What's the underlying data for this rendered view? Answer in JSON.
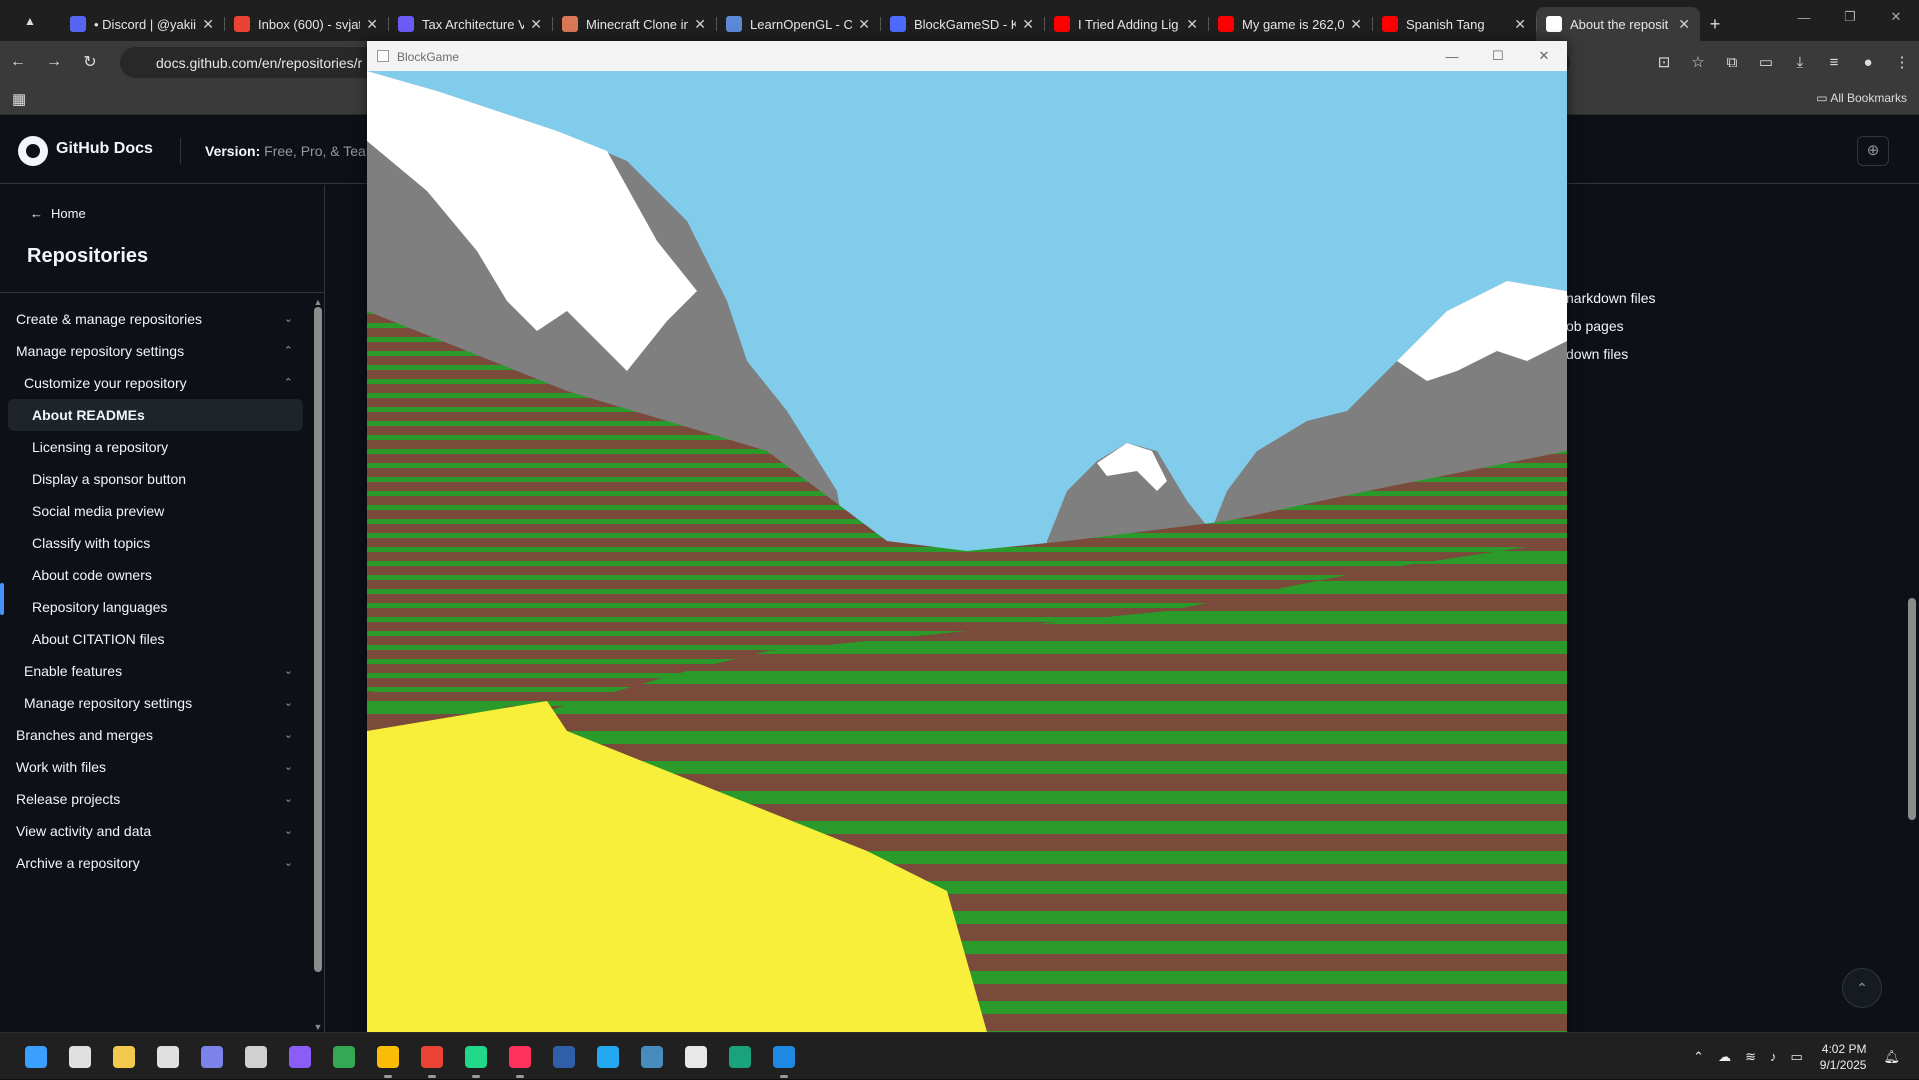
{
  "browser": {
    "tabs": [
      {
        "title": "• Discord | @yakii",
        "color": "#5865f2",
        "active": false
      },
      {
        "title": "Inbox (600) - svjat",
        "color": "#ea4335",
        "active": false
      },
      {
        "title": "Tax Architecture V",
        "color": "#6b5cf6",
        "active": false
      },
      {
        "title": "Minecraft Clone in",
        "color": "#d97757",
        "active": false
      },
      {
        "title": "LearnOpenGL - C",
        "color": "#5c8ad6",
        "active": false
      },
      {
        "title": "BlockGameSD - K",
        "color": "#4d6bfe",
        "active": false
      },
      {
        "title": "I Tried Adding Lig",
        "color": "#ff0000",
        "active": false
      },
      {
        "title": "My game is 262,0",
        "color": "#ff0000",
        "active": false
      },
      {
        "title": "Spanish Tang",
        "color": "#ff0000",
        "active": false
      },
      {
        "title": "About the reposit",
        "color": "#ffffff",
        "active": true
      }
    ],
    "url": "docs.github.com/en/repositories/r",
    "bookmarks_all": "All Bookmarks"
  },
  "docs": {
    "brand": "GitHub Docs",
    "version_label": "Version:",
    "version_value": "Free, Pro, & Team",
    "home_link": "Home",
    "section_title": "Repositories",
    "nav": [
      {
        "label": "Create & manage repositories",
        "level": 0,
        "chevron": "down"
      },
      {
        "label": "Manage repository settings",
        "level": 0,
        "chevron": "up"
      },
      {
        "label": "Customize your repository",
        "level": 1,
        "chevron": "up"
      },
      {
        "label": "About READMEs",
        "level": 2,
        "chevron": "",
        "active": true
      },
      {
        "label": "Licensing a repository",
        "level": 2,
        "chevron": ""
      },
      {
        "label": "Display a sponsor button",
        "level": 2,
        "chevron": ""
      },
      {
        "label": "Social media preview",
        "level": 2,
        "chevron": ""
      },
      {
        "label": "Classify with topics",
        "level": 2,
        "chevron": ""
      },
      {
        "label": "About code owners",
        "level": 2,
        "chevron": ""
      },
      {
        "label": "Repository languages",
        "level": 2,
        "chevron": ""
      },
      {
        "label": "About CITATION files",
        "level": 2,
        "chevron": ""
      },
      {
        "label": "Enable features",
        "level": 1,
        "chevron": "down"
      },
      {
        "label": "Manage repository settings",
        "level": 1,
        "chevron": "down"
      },
      {
        "label": "Branches and merges",
        "level": 0,
        "chevron": "down"
      },
      {
        "label": "Work with files",
        "level": 0,
        "chevron": "down"
      },
      {
        "label": "Release projects",
        "level": 0,
        "chevron": "down"
      },
      {
        "label": "View activity and data",
        "level": 0,
        "chevron": "down"
      },
      {
        "label": "Archive a repository",
        "level": 0,
        "chevron": "down"
      }
    ],
    "visible_links": [
      "narkdown files",
      "ob pages",
      "down files"
    ]
  },
  "game_window": {
    "title": "BlockGame",
    "colors": {
      "sky": "#81cceb",
      "snow": "#ffffff",
      "stone": "#7f7f7f",
      "dirt": "#7a4a3a",
      "grass": "#2a9a2a",
      "sand": "#f7ef3a"
    }
  },
  "taskbar": {
    "time": "4:02 PM",
    "date": "9/1/2025",
    "apps": [
      {
        "name": "start-icon",
        "color": "#3aa0ff"
      },
      {
        "name": "search-icon",
        "color": "#e0e0e0"
      },
      {
        "name": "file-explorer-icon",
        "color": "#f2c94c"
      },
      {
        "name": "twitch-icon",
        "color": "#e0e0e0"
      },
      {
        "name": "teams-icon",
        "color": "#7b83eb"
      },
      {
        "name": "xbox-icon",
        "color": "#d0d0d0"
      },
      {
        "name": "obsidian-icon",
        "color": "#8b5cf6"
      },
      {
        "name": "chrome-icon",
        "color": "#34a853"
      },
      {
        "name": "chrome-profile-icon",
        "color": "#fbbc05"
      },
      {
        "name": "chrome-active-icon",
        "color": "#ea4335"
      },
      {
        "name": "clion-icon",
        "color": "#21d789"
      },
      {
        "name": "intellij-icon",
        "color": "#fe315d"
      },
      {
        "name": "powershell-icon",
        "color": "#2f5fa8"
      },
      {
        "name": "vscode-icon",
        "color": "#23a9f2"
      },
      {
        "name": "godot-icon",
        "color": "#478cbf"
      },
      {
        "name": "notepad-icon",
        "color": "#e8e8e8"
      },
      {
        "name": "photo-app-icon",
        "color": "#1aa37a"
      },
      {
        "name": "blockgame-icon",
        "color": "#1e88e5"
      }
    ]
  }
}
